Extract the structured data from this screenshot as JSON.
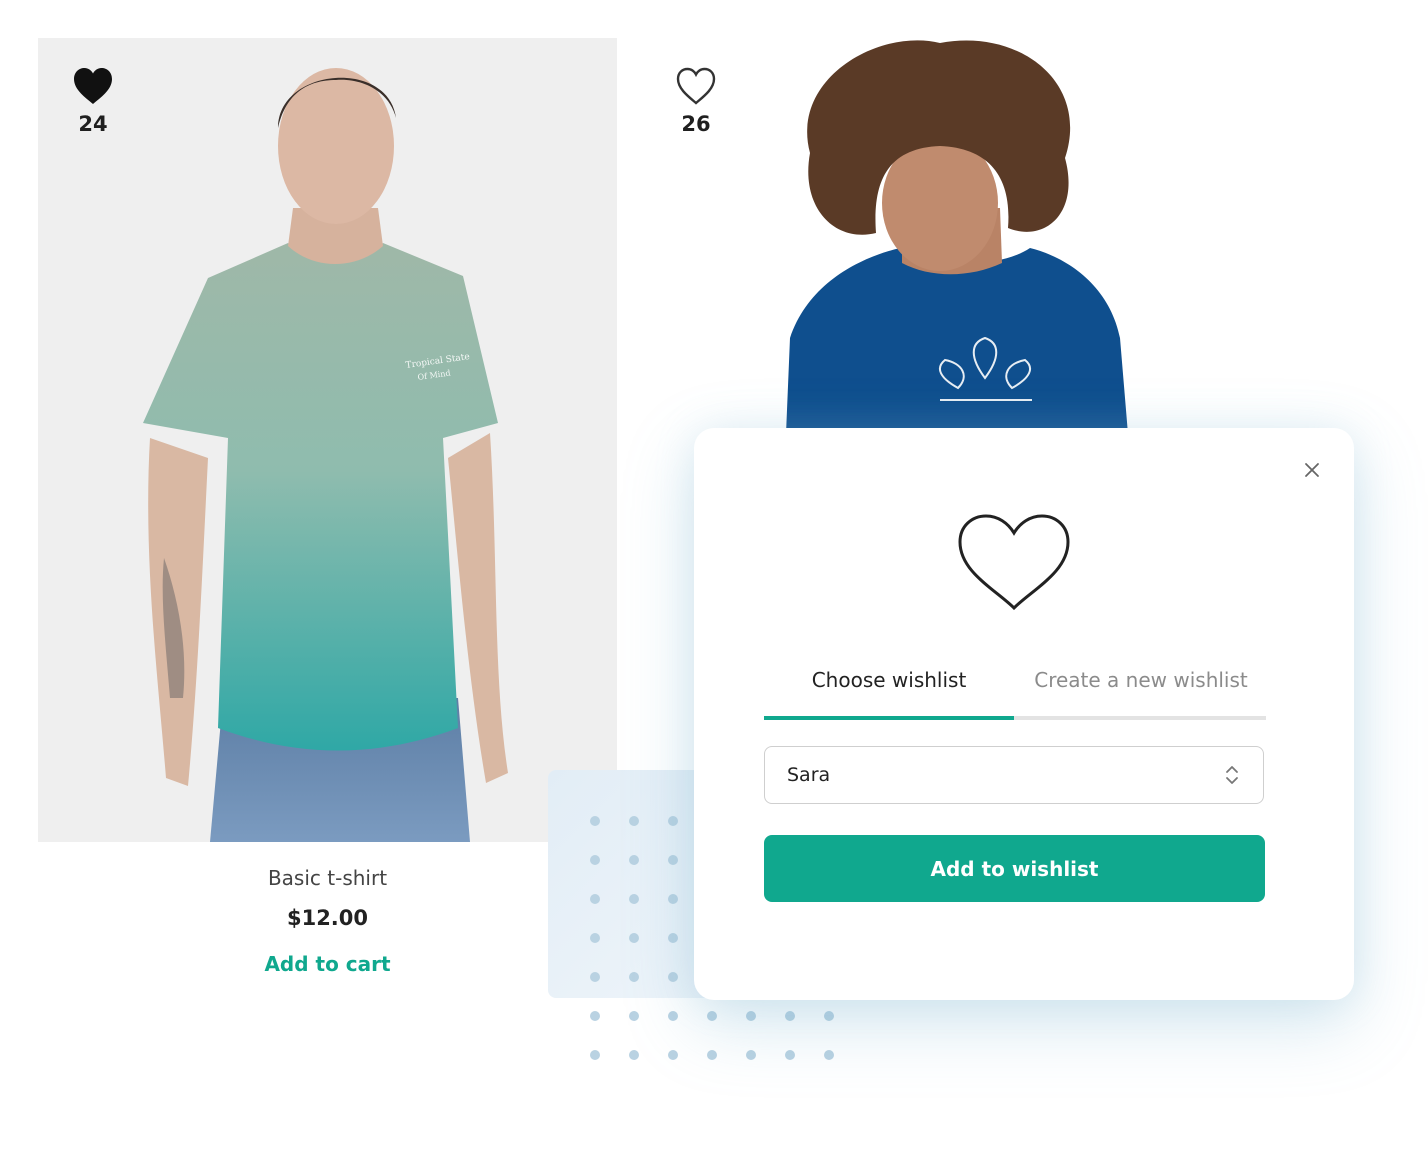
{
  "colors": {
    "accent": "#10a88e",
    "heart_filled": "#111111",
    "heart_outline": "#333333",
    "dots": "#b9d2e2"
  },
  "products": [
    {
      "like_count": "24",
      "liked": true,
      "name": "Basic t-shirt",
      "price": "$12.00",
      "cart_label": "Add to cart"
    },
    {
      "like_count": "26",
      "liked": false
    }
  ],
  "modal": {
    "icon": "heart-outline-icon",
    "close_icon": "close-icon",
    "tabs": [
      {
        "label": "Choose wishlist",
        "active": true
      },
      {
        "label": "Create a new wishlist",
        "active": false
      }
    ],
    "select": {
      "value": "Sara",
      "icon": "updown-chevron-icon"
    },
    "submit_label": "Add to wishlist"
  }
}
